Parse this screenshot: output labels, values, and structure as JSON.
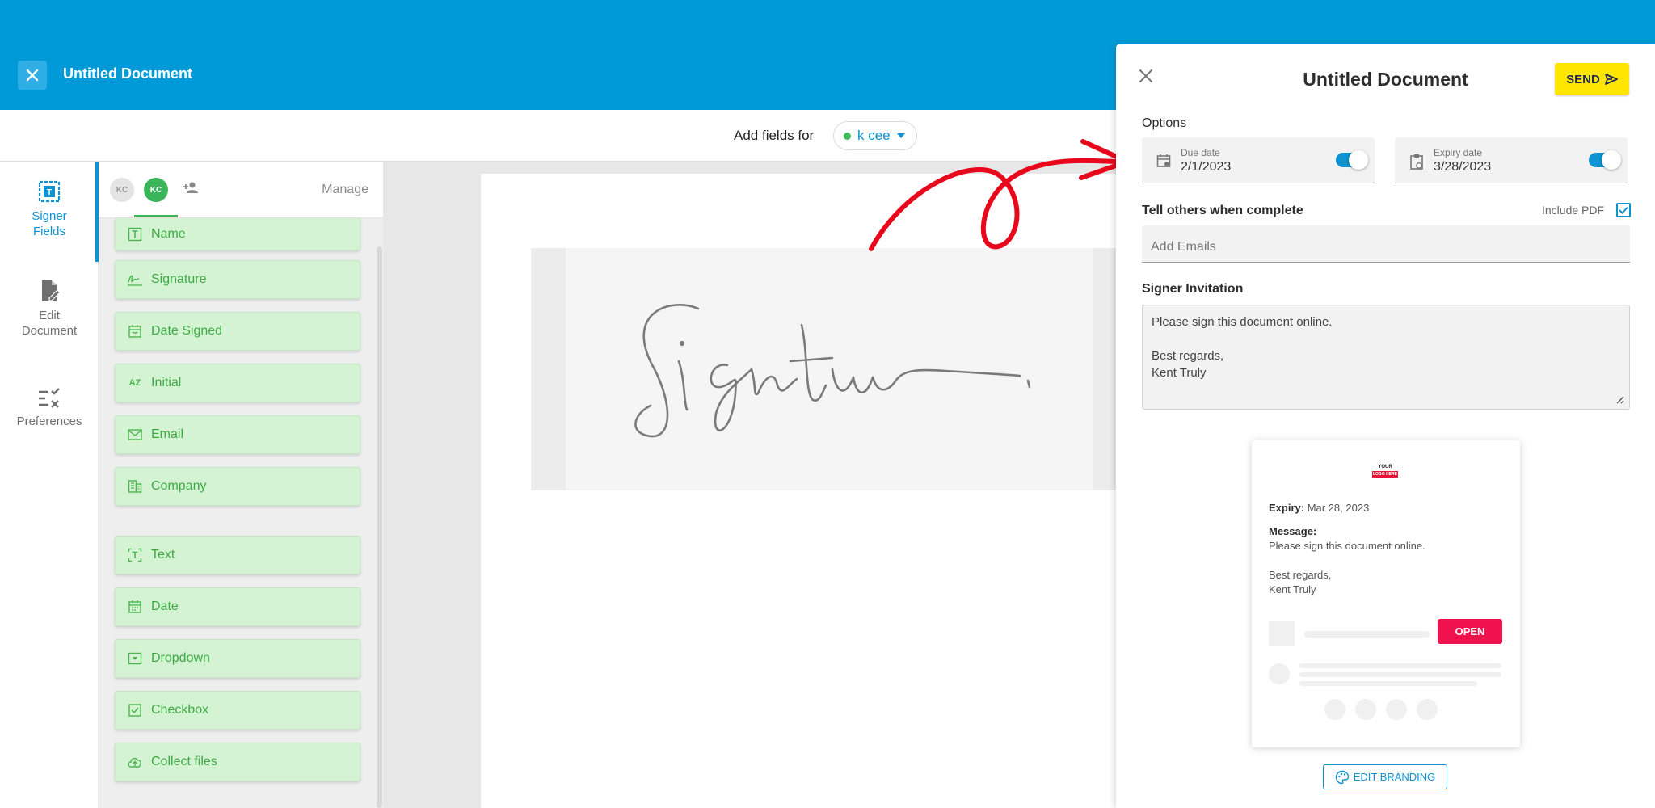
{
  "app": {
    "title": "Untitled Document"
  },
  "toolbar": {
    "add_fields_label": "Add fields for",
    "signer_name": "k cee"
  },
  "rail": {
    "items": [
      {
        "label_line1": "Signer",
        "label_line2": "Fields",
        "icon": "signer-fields-icon",
        "active": true
      },
      {
        "label_line1": "Edit",
        "label_line2": "Document",
        "icon": "edit-document-icon",
        "active": false
      },
      {
        "label_line1": "Preferences",
        "label_line2": "",
        "icon": "preferences-icon",
        "active": false
      }
    ]
  },
  "palette": {
    "signers": [
      {
        "initials": "KC",
        "active": false
      },
      {
        "initials": "KC",
        "active": true
      }
    ],
    "manage_label": "Manage",
    "fields": [
      {
        "label": "Name",
        "icon": "name-field-icon"
      },
      {
        "label": "Signature",
        "icon": "signature-icon"
      },
      {
        "label": "Date Signed",
        "icon": "date-signed-icon"
      },
      {
        "label": "Initial",
        "icon": "initial-icon",
        "glyph": "AZ"
      },
      {
        "label": "Email",
        "icon": "email-icon"
      },
      {
        "label": "Company",
        "icon": "company-icon"
      },
      {
        "label": "Text",
        "icon": "text-field-icon"
      },
      {
        "label": "Date",
        "icon": "date-icon"
      },
      {
        "label": "Dropdown",
        "icon": "dropdown-icon"
      },
      {
        "label": "Checkbox",
        "icon": "checkbox-icon"
      },
      {
        "label": "Collect files",
        "icon": "upload-cloud-icon"
      }
    ]
  },
  "canvas": {
    "signature_graphic": "handwritten signature"
  },
  "panel": {
    "title": "Untitled Document",
    "send_label": "SEND",
    "options_label": "Options",
    "due_date": {
      "label": "Due date",
      "value": "2/1/2023",
      "enabled": true
    },
    "expiry_date": {
      "label": "Expiry date",
      "value": "3/28/2023",
      "enabled": true
    },
    "notify_label": "Tell others when complete",
    "include_pdf_label": "Include PDF",
    "include_pdf_checked": true,
    "emails_placeholder": "Add Emails",
    "invitation_label": "Signer Invitation",
    "invitation_lines": [
      "Please sign this document online.",
      "",
      "Best regards,",
      "Kent Truly"
    ],
    "preview": {
      "logo_line1": "YOUR",
      "logo_line2": "LOGO HERE",
      "expiry_label": "Expiry:",
      "expiry_value": "Mar 28, 2023",
      "message_label": "Message:",
      "message_lines": [
        "Please sign this document online.",
        "",
        "Best regards,",
        "Kent Truly"
      ],
      "open_label": "OPEN"
    },
    "edit_branding_label": "EDIT BRANDING"
  },
  "colors": {
    "brand_blue": "#009ad8",
    "accent_blue": "#0d93d2",
    "field_green_bg": "#d4f3d3",
    "field_green_text": "#3eaa44",
    "send_yellow": "#ffe600",
    "open_pink": "#f0124d",
    "annotation_red": "#e8081c"
  }
}
